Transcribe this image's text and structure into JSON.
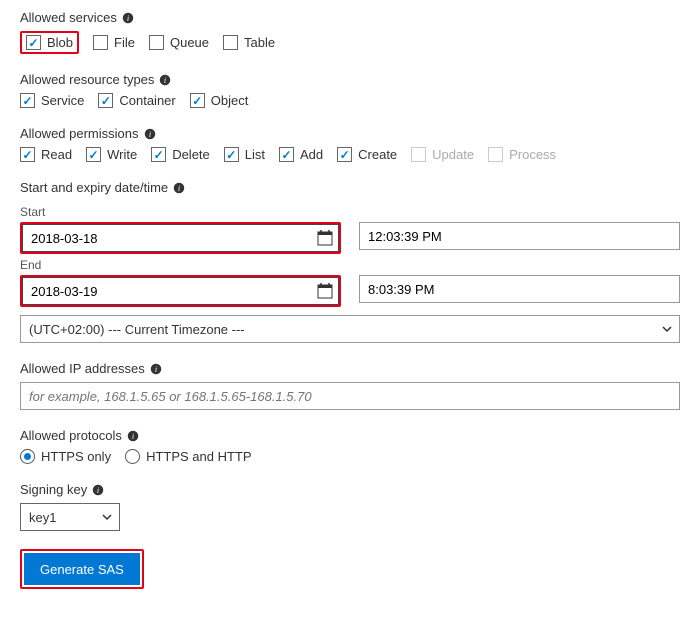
{
  "services": {
    "label": "Allowed services",
    "items": [
      {
        "label": "Blob",
        "checked": true,
        "highlight": true
      },
      {
        "label": "File",
        "checked": false
      },
      {
        "label": "Queue",
        "checked": false
      },
      {
        "label": "Table",
        "checked": false
      }
    ]
  },
  "resource_types": {
    "label": "Allowed resource types",
    "items": [
      {
        "label": "Service",
        "checked": true
      },
      {
        "label": "Container",
        "checked": true
      },
      {
        "label": "Object",
        "checked": true
      }
    ]
  },
  "permissions": {
    "label": "Allowed permissions",
    "items": [
      {
        "label": "Read",
        "checked": true
      },
      {
        "label": "Write",
        "checked": true
      },
      {
        "label": "Delete",
        "checked": true
      },
      {
        "label": "List",
        "checked": true
      },
      {
        "label": "Add",
        "checked": true
      },
      {
        "label": "Create",
        "checked": true
      },
      {
        "label": "Update",
        "checked": false,
        "disabled": true
      },
      {
        "label": "Process",
        "checked": false,
        "disabled": true
      }
    ]
  },
  "datetime": {
    "label": "Start and expiry date/time",
    "start_label": "Start",
    "end_label": "End",
    "start_date": "2018-03-18",
    "start_time": "12:03:39 PM",
    "end_date": "2018-03-19",
    "end_time": "8:03:39 PM",
    "timezone": "(UTC+02:00) --- Current Timezone ---"
  },
  "ip": {
    "label": "Allowed IP addresses",
    "placeholder": "for example, 168.1.5.65 or 168.1.5.65-168.1.5.70"
  },
  "protocols": {
    "label": "Allowed protocols",
    "options": [
      {
        "label": "HTTPS only",
        "selected": true
      },
      {
        "label": "HTTPS and HTTP",
        "selected": false
      }
    ]
  },
  "signing_key": {
    "label": "Signing key",
    "value": "key1"
  },
  "generate_label": "Generate SAS"
}
